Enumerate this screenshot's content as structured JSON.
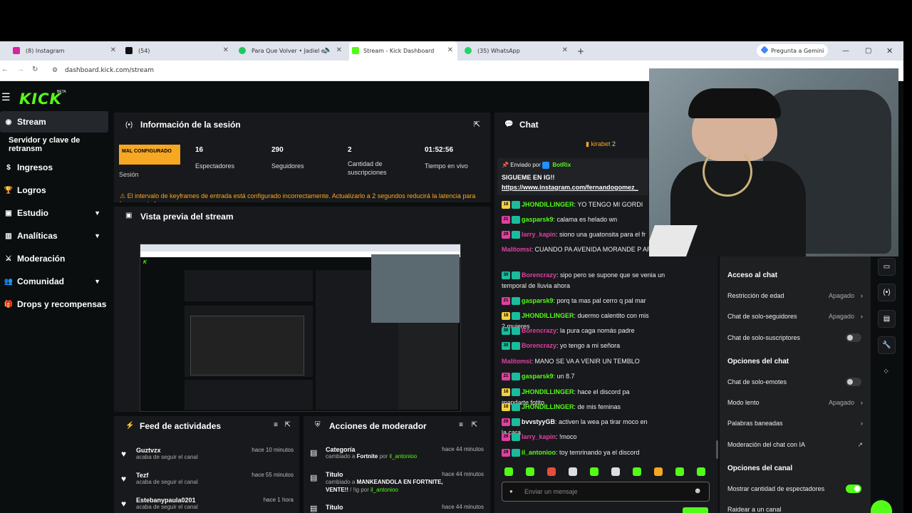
{
  "browser": {
    "tabs": [
      {
        "title": "(8) Instagram",
        "color": "#d6249f"
      },
      {
        "title": "(54)",
        "color": "#111111"
      },
      {
        "title": "Para Que Volver • Jadiel el",
        "color": "#22c55e"
      },
      {
        "title": "Stream - Kick Dashboard",
        "color": "#53fc18"
      },
      {
        "title": "(35) WhatsApp",
        "color": "#25d366"
      }
    ],
    "new_tab": "+",
    "gemini": "Pregunta a Gemini",
    "url": "dashboard.kick.com/stream"
  },
  "logo": "KICK",
  "logo_beta": "BETA",
  "nav": [
    {
      "label": "Stream",
      "icon": "stream-icon"
    },
    {
      "label": "Servidor y clave de retransm"
    },
    {
      "label": "Ingresos",
      "icon": "dollar-icon"
    },
    {
      "label": "Logros",
      "icon": "trophy-icon"
    },
    {
      "label": "Estudio",
      "icon": "studio-icon",
      "chev": "⌄"
    },
    {
      "label": "Analíticas",
      "icon": "chart-icon",
      "chev": "⌄"
    },
    {
      "label": "Moderación",
      "icon": "sword-icon"
    },
    {
      "label": "Comunidad",
      "icon": "people-icon",
      "chev": "⌄"
    },
    {
      "label": "Drops y recompensas",
      "icon": "gift-icon"
    }
  ],
  "session": {
    "title": "Información de la sesión",
    "status": "MAL CONFIGURADO",
    "status_label": "Sesión",
    "stats": [
      {
        "value": "16",
        "label": "Espectadores"
      },
      {
        "value": "290",
        "label": "Seguidores"
      },
      {
        "value": "2",
        "label": "Cantidad de suscripciones"
      },
      {
        "value": "01:52:56",
        "label": "Tiempo en vivo"
      }
    ],
    "warning": "El intervalo de keyframes de entrada está configurado incorrectamente. Actualizarlo a 2 segundos reducirá la latencia para los espectadores."
  },
  "preview": {
    "title": "Vista previa del stream"
  },
  "feed": {
    "title": "Feed de actividades",
    "items": [
      {
        "name": "Guztvzx",
        "sub": "acaba de seguir el canal",
        "time": "hace 10 minutos"
      },
      {
        "name": "Tezf",
        "sub": "acaba de seguir el canal",
        "time": "hace 55 minutos"
      },
      {
        "name": "Estebanypaula0201",
        "sub": "acaba de seguir el canal",
        "time": "hace 1 hora"
      }
    ]
  },
  "modactions": {
    "title": "Acciones de moderador",
    "items": [
      {
        "name": "Categoría",
        "sub_pre": "cambiado a ",
        "sub_val": "Fortnite",
        "sub_by": " por ",
        "user": "il_antonioo",
        "time": "hace 44 minutos"
      },
      {
        "name": "Título",
        "sub_pre": "cambiado a ",
        "sub_val": "MANKEANDOLA EN FORTNITE, VENTE!!",
        "sub_by": " / !ig por ",
        "user": "il_antonioo",
        "time": "hace 44 minutos"
      },
      {
        "name": "Título",
        "sub_pre": "",
        "sub_val": "",
        "sub_by": "",
        "user": "",
        "time": "hace 44 minutos"
      }
    ]
  },
  "chat": {
    "title": "Chat",
    "top_user": "kirabet",
    "top_count": "2",
    "pinned_by": "Enviado por",
    "pinned_bot": "BotRix",
    "pinned_msg": "SIGUEME EN IG!!",
    "pinned_link": "https://www.instagram.com/fernandogomez_",
    "messages": [
      {
        "user": "JHONDILLINGER",
        "color": "#53fc18",
        "badge": "18",
        "badgecolor": "#f4d03f",
        "text": ": YO TENGO MI GORDI"
      },
      {
        "user": "gasparsk9",
        "color": "#53fc18",
        "badge": "21",
        "badgecolor": "#e040a0",
        "text": ": calama es helado wn"
      },
      {
        "user": "larry_kapin",
        "color": "#e040a0",
        "badge": "29",
        "badgecolor": "#e040a0",
        "text": ": siono una guatonsita para el fr"
      },
      {
        "user": "Malitomsi",
        "color": "#e040a0",
        "badge": "",
        "badgecolor": "",
        "text": ": CUANDO PA AVENIDA MORANDE P ARMA"
      },
      {
        "user": "Borencrazy",
        "color": "#e040a0",
        "badge": "30",
        "badgecolor": "#1abc9c",
        "text": ": sipo pero se supone que se venia un temporal de lluvia ahora"
      },
      {
        "user": "gasparsk9",
        "color": "#53fc18",
        "badge": "21",
        "badgecolor": "#e040a0",
        "text": ": porq ta mas pal cerro q pal mar"
      },
      {
        "user": "JHONDILLINGER",
        "color": "#53fc18",
        "badge": "18",
        "badgecolor": "#f4d03f",
        "text": ": duermo calentito con mis 2 mujeres"
      },
      {
        "user": "Borencrazy",
        "color": "#e040a0",
        "badge": "30",
        "badgecolor": "#1abc9c",
        "text": ": la pura caga nomás padre"
      },
      {
        "user": "Borencrazy",
        "color": "#e040a0",
        "badge": "30",
        "badgecolor": "#1abc9c",
        "text": ": yo tengo a mi señora"
      },
      {
        "user": "Malitomsi",
        "color": "#e040a0",
        "badge": "",
        "badgecolor": "",
        "text": ": MANO SE VA A VENIR UN TEMBLO"
      },
      {
        "user": "gasparsk9",
        "color": "#53fc18",
        "badge": "21",
        "badgecolor": "#e040a0",
        "text": ": un 8.7"
      },
      {
        "user": "JHONDILLINGER",
        "color": "#53fc18",
        "badge": "18",
        "badgecolor": "#f4d03f",
        "text": ": hace el discord pa mandarte fotito"
      },
      {
        "user": "JHONDILLINGER",
        "color": "#53fc18",
        "badge": "18",
        "badgecolor": "#f4d03f",
        "text": ": de mis feminas"
      },
      {
        "user": "bvvstyyGB",
        "color": "#fff",
        "badge": "29",
        "badgecolor": "#e040a0",
        "text": ": activen la wea pa tirar moco en la cara"
      },
      {
        "user": "larry_kapin",
        "color": "#e040a0",
        "badge": "29",
        "badgecolor": "#e040a0",
        "text": ": !moco"
      },
      {
        "user": "il_antonioo",
        "color": "#53fc18",
        "badge": "29",
        "badgecolor": "#e040a0",
        "text": ": toy temrinando ya el discord"
      }
    ],
    "input_placeholder": "Enviar un mensaje"
  },
  "settings": {
    "sec1": "Acceso al chat",
    "age": "Restricción de edad",
    "age_v": "Apagado",
    "followers": "Chat de solo-seguidores",
    "followers_v": "Apagado",
    "subs": "Chat de solo-suscriptores",
    "sec2": "Opciones del chat",
    "emotes": "Chat de solo-emotes",
    "slow": "Modo lento",
    "slow_v": "Apagado",
    "banned": "Palabras baneadas",
    "ai": "Moderación del chat con IA",
    "sec3": "Opciones del canal",
    "show_viewers": "Mostrar cantidad de espectadores",
    "raid": "Raidear a un canal"
  }
}
